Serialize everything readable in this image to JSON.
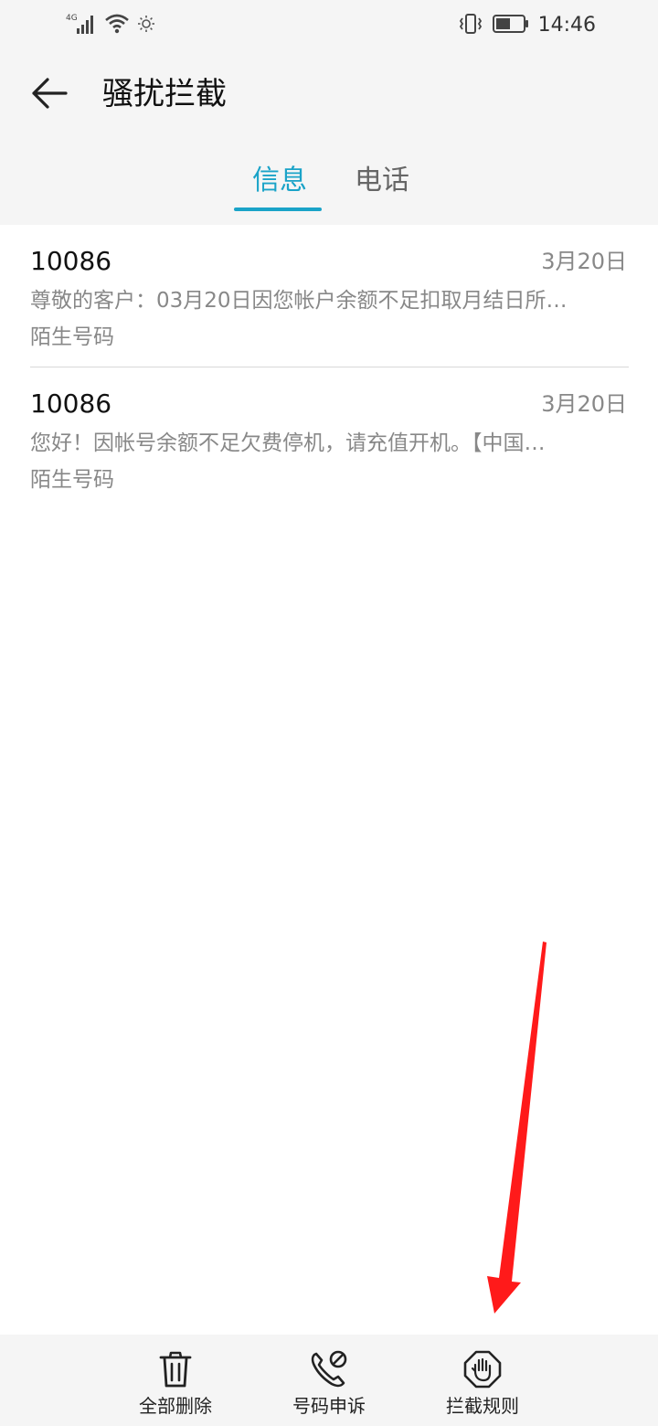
{
  "status_bar": {
    "network": "4G",
    "time": "14:46"
  },
  "header": {
    "title": "骚扰拦截"
  },
  "tabs": [
    {
      "label": "信息",
      "selected": true
    },
    {
      "label": "电话",
      "selected": false
    }
  ],
  "messages": [
    {
      "sender": "10086",
      "date": "3月20日",
      "preview": "尊敬的客户：03月20日因您帐户余额不足扣取月结日所…",
      "tag": "陌生号码"
    },
    {
      "sender": "10086",
      "date": "3月20日",
      "preview": "您好！因帐号余额不足欠费停机，请充值开机。【中国…",
      "tag": "陌生号码"
    }
  ],
  "toolbar": {
    "delete_all_label": "全部删除",
    "appeal_label": "号码申诉",
    "rules_label": "拦截规则"
  },
  "colors": {
    "accent": "#1aa3c8",
    "annotation_arrow": "#ff1a1a",
    "bar_background": "#f5f5f5"
  },
  "icons": {
    "back": "arrow-left-icon",
    "delete_all": "trash-icon",
    "appeal": "phone-block-icon",
    "rules": "hand-stop-icon"
  }
}
